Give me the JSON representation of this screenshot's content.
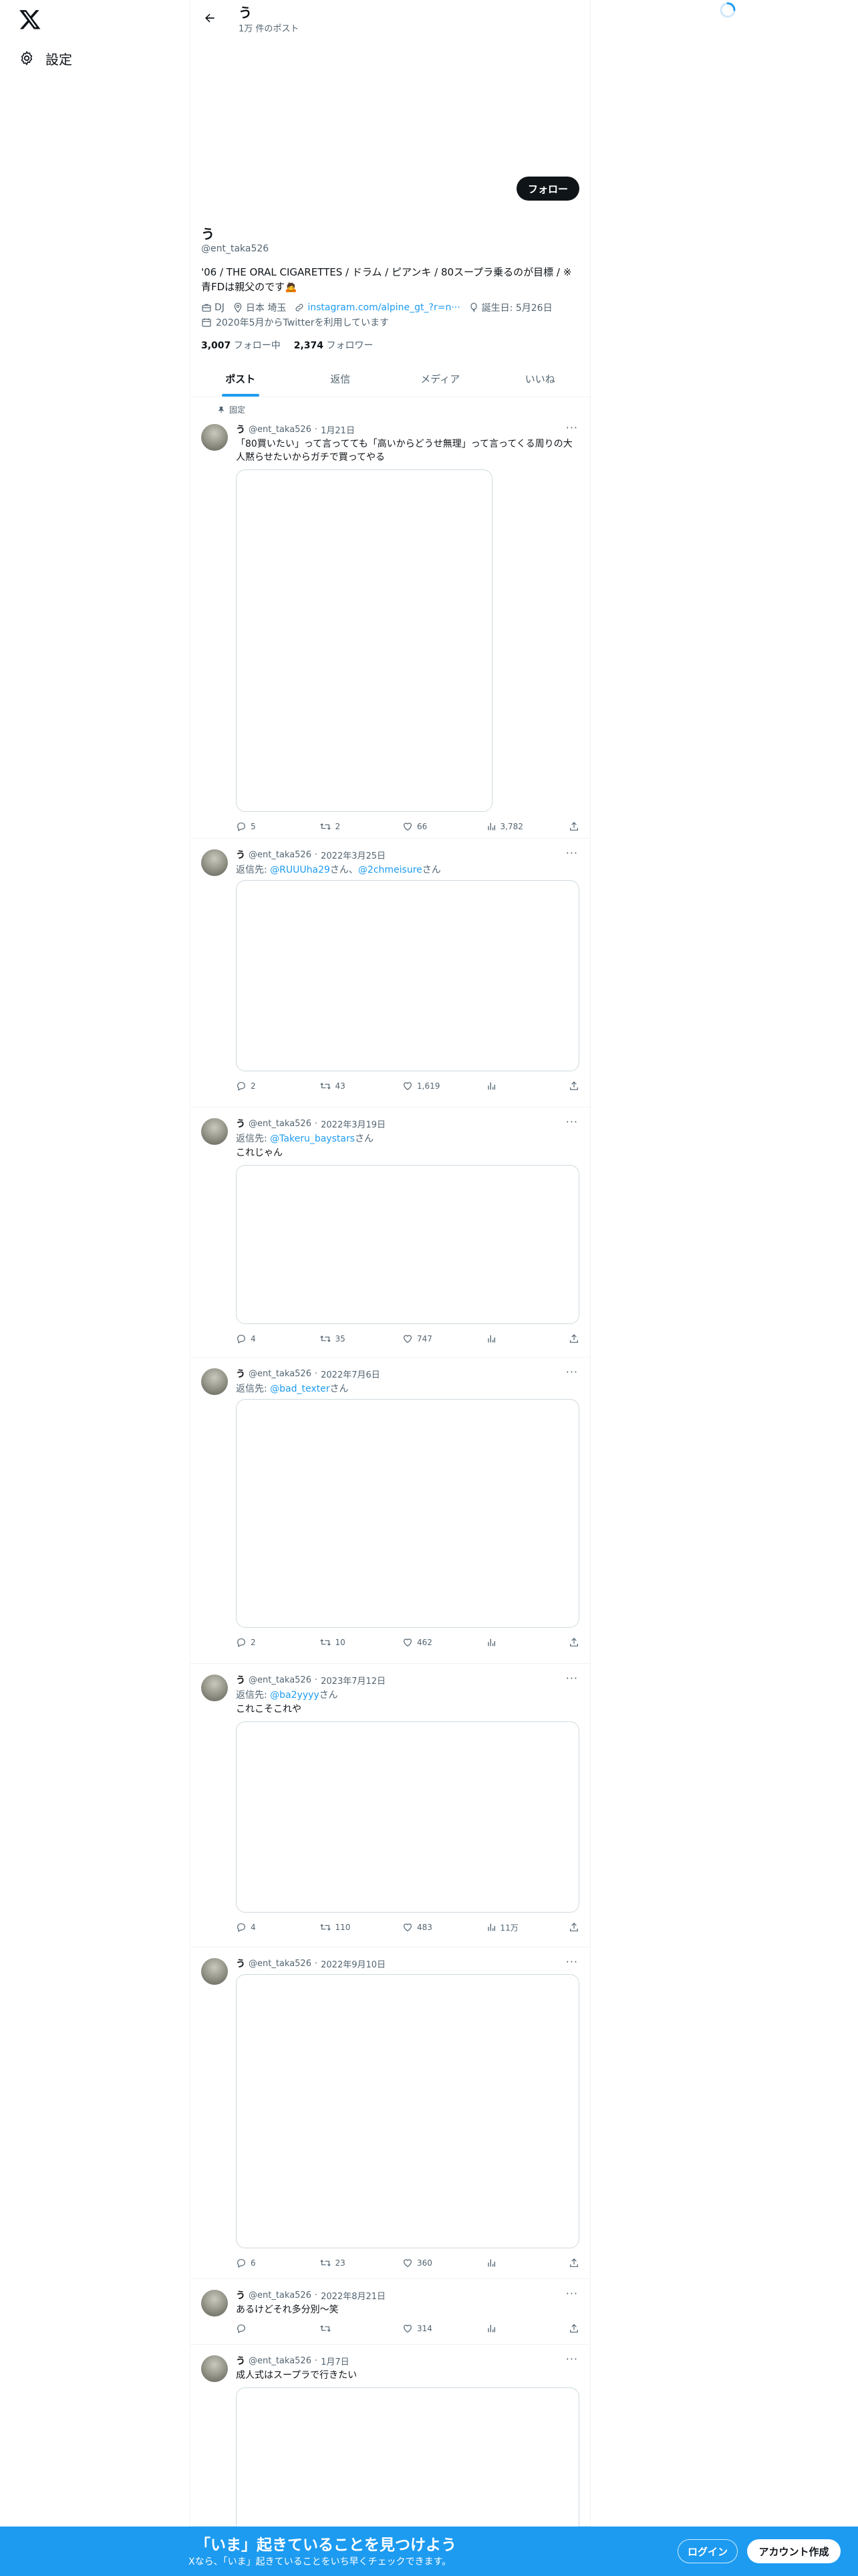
{
  "nav": {
    "settings_label": "設定"
  },
  "header": {
    "name": "う",
    "post_count": "1万 件のポスト"
  },
  "profile": {
    "follow_label": "フォロー",
    "name": "う",
    "handle": "@ent_taka526",
    "bio": "'06 / THE ORAL CIGARETTES / ドラム / ピアンキ / 80スープラ乗るのが目標 / ※青FDは親父のです🙇",
    "category": "DJ",
    "location": "日本 埼玉",
    "website": "instagram.com/alpine_gt_?r=n···",
    "birthday": "誕生日: 5月26日",
    "joined": "2020年5月からTwitterを利用しています",
    "following_count": "3,007",
    "following_label": "フォロー中",
    "followers_count": "2,374",
    "followers_label": "フォロワー"
  },
  "tabs": [
    "ポスト",
    "返信",
    "メディア",
    "いいね"
  ],
  "tweets": [
    {
      "pinned_label": "固定",
      "name": "う",
      "handle": "@ent_taka526",
      "date": "1月21日",
      "reply_to": [],
      "text": "「80買いたい」って言ってても「高いからどうせ無理」って言ってくる周りの大人黙らせたいからガチで買ってやる",
      "replies": "5",
      "reposts": "2",
      "likes": "66",
      "views": "3,782"
    },
    {
      "name": "う",
      "handle": "@ent_taka526",
      "date": "2022年3月25日",
      "reply_to": [
        "@RUUUha29",
        "@2chmeisure"
      ],
      "text": "",
      "replies": "2",
      "reposts": "43",
      "likes": "1,619",
      "views": ""
    },
    {
      "name": "う",
      "handle": "@ent_taka526",
      "date": "2022年3月19日",
      "reply_to": [
        "@Takeru_baystars"
      ],
      "text": "これじゃん",
      "replies": "4",
      "reposts": "35",
      "likes": "747",
      "views": ""
    },
    {
      "name": "う",
      "handle": "@ent_taka526",
      "date": "2022年7月6日",
      "reply_to": [
        "@bad_texter"
      ],
      "text": "",
      "replies": "2",
      "reposts": "10",
      "likes": "462",
      "views": ""
    },
    {
      "name": "う",
      "handle": "@ent_taka526",
      "date": "2023年7月12日",
      "reply_to": [
        "@ba2yyyy"
      ],
      "text": "これこそこれや",
      "replies": "4",
      "reposts": "110",
      "likes": "483",
      "views": "11万"
    },
    {
      "name": "う",
      "handle": "@ent_taka526",
      "date": "2022年9月10日",
      "reply_to": [],
      "text": "",
      "replies": "6",
      "reposts": "23",
      "likes": "360",
      "views": ""
    },
    {
      "name": "う",
      "handle": "@ent_taka526",
      "date": "2022年8月21日",
      "reply_to": [],
      "text": "あるけどそれ多分別〜笑",
      "replies": "",
      "reposts": "",
      "likes": "314",
      "views": ""
    },
    {
      "name": "う",
      "handle": "@ent_taka526",
      "date": "1月7日",
      "reply_to": [],
      "text": "成人式はスープラで行きたい",
      "replies": "",
      "reposts": "",
      "likes": "",
      "views": ""
    }
  ],
  "reply_prefix": "返信先: ",
  "reply_suffix": "さん",
  "reply_joiner": "、",
  "bottom_bar": {
    "title": "「いま」起きていることを見つけよう",
    "subtitle": "Xなら、「いま」起きていることをいち早くチェックできます。",
    "login_label": "ログイン",
    "signup_label": "アカウント作成"
  },
  "colors": {
    "accent": "#1d9bf0",
    "text": "#0f1419",
    "muted": "#536471",
    "border": "#eff3f4"
  }
}
